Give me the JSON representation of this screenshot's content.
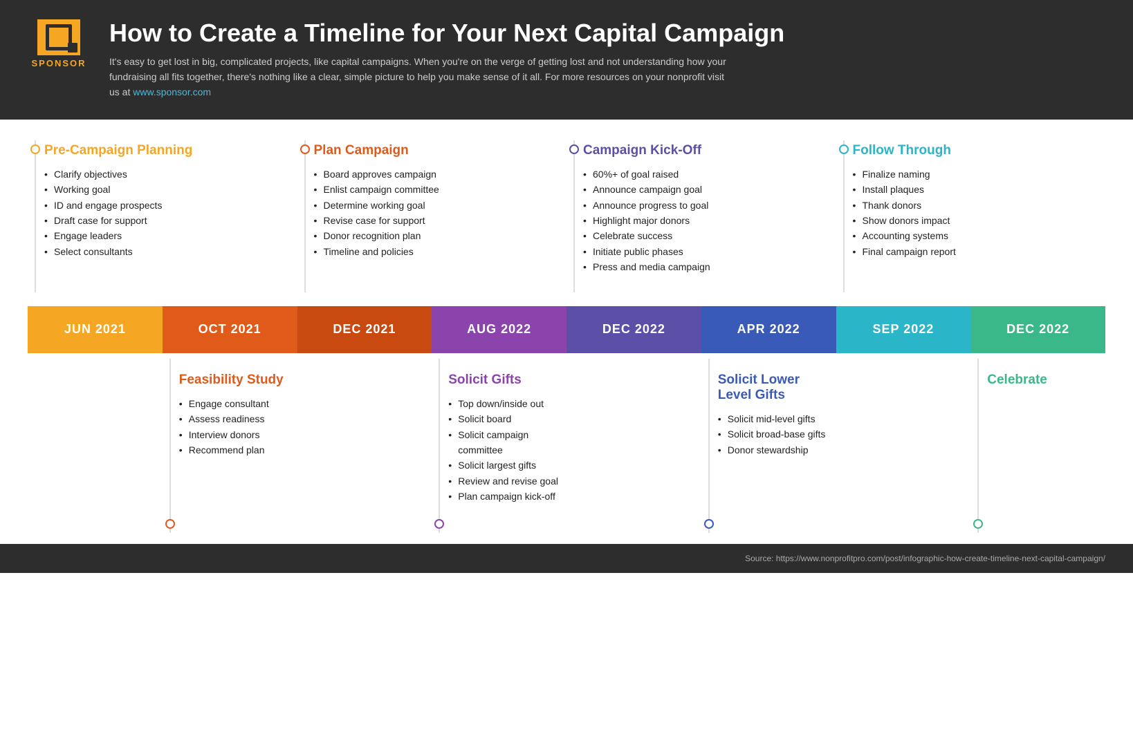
{
  "header": {
    "logo_text": "SPONSOR",
    "title": "How to Create a Timeline for Your Next Capital Campaign",
    "description": "It's easy to get lost in big, complicated projects, like capital campaigns. When you're on the verge of getting lost and not understanding how your fundraising all fits together, there's nothing like a clear, simple picture to help you make sense of it all. For more resources on your nonprofit visit us at",
    "link_text": "www.sponsor.com"
  },
  "phases_top": [
    {
      "id": "pre-campaign",
      "title": "Pre-Campaign Planning",
      "color": "orange",
      "items": [
        "Clarify objectives",
        "Working goal",
        "ID and engage prospects",
        "Draft case for support",
        "Engage leaders",
        "Select consultants"
      ]
    },
    {
      "id": "plan-campaign",
      "title": "Plan Campaign",
      "color": "red-orange",
      "items": [
        "Board approves campaign",
        "Enlist campaign committee",
        "Determine working goal",
        "Revise case for support",
        "Donor recognition plan",
        "Timeline and policies"
      ]
    },
    {
      "id": "campaign-kickoff",
      "title": "Campaign Kick-Off",
      "color": "blue-purple",
      "items": [
        "60%+ of goal raised",
        "Announce campaign goal",
        "Announce progress to goal",
        "Highlight major donors",
        "Celebrate success",
        "Initiate public phases",
        "Press and media campaign"
      ]
    },
    {
      "id": "follow-through",
      "title": "Follow Through",
      "color": "teal",
      "items": [
        "Finalize naming",
        "Install plaques",
        "Thank donors",
        "Show donors impact",
        "Accounting systems",
        "Final campaign report"
      ]
    }
  ],
  "dates": [
    {
      "label": "JUN 2021",
      "color": "bg-orange"
    },
    {
      "label": "OCT 2021",
      "color": "bg-red-orange"
    },
    {
      "label": "DEC 2021",
      "color": "bg-dark-orange"
    },
    {
      "label": "AUG 2022",
      "color": "bg-purple"
    },
    {
      "label": "DEC 2022",
      "color": "bg-blue-purple"
    },
    {
      "label": "APR 2022",
      "color": "bg-blue"
    },
    {
      "label": "SEP 2022",
      "color": "bg-teal"
    },
    {
      "label": "DEC 2022",
      "color": "bg-green"
    }
  ],
  "phases_bottom": [
    {
      "id": "feasibility",
      "col_start": 2,
      "title": "Feasibility Study",
      "color": "red-orange",
      "items": [
        "Engage consultant",
        "Assess readiness",
        "Interview donors",
        "Recommend plan"
      ]
    },
    {
      "id": "solicit-gifts",
      "col_start": 4,
      "title": "Solicit Gifts",
      "color": "purple",
      "items": [
        "Top down/inside out",
        "Solicit board",
        "Solicit campaign committee",
        "Solicit largest gifts",
        "Review and revise goal",
        "Plan campaign kick-off"
      ]
    },
    {
      "id": "solicit-lower",
      "col_start": 6,
      "title": "Solicit Lower Level Gifts",
      "color": "blue",
      "items": [
        "Solicit mid-level gifts",
        "Solicit broad-base gifts",
        "Donor stewardship"
      ]
    },
    {
      "id": "celebrate",
      "col_start": 8,
      "title": "Celebrate",
      "color": "green",
      "items": []
    }
  ],
  "source": "Source: https://www.nonprofitpro.com/post/infographic-how-create-timeline-next-capital-campaign/"
}
